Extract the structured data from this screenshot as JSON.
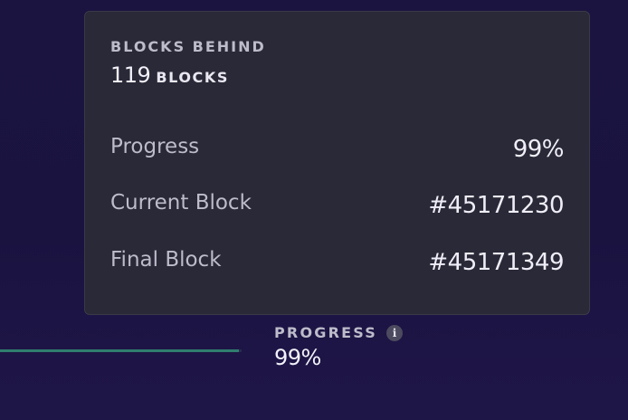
{
  "tooltip": {
    "title": "BLOCKS BEHIND",
    "blocks_count": "119",
    "blocks_unit": "BLOCKS",
    "rows": [
      {
        "label": "Progress",
        "value": "99%"
      },
      {
        "label": "Current Block",
        "value": "#45171230"
      },
      {
        "label": "Final Block",
        "value": "#45171349"
      }
    ]
  },
  "sync": {
    "label": "PROGRESS",
    "info_icon": "info-icon",
    "value": "99%",
    "progress_fraction": 0.99
  },
  "colors": {
    "background": "#1b1440",
    "card": "#2a2937",
    "bar_fill": "#2f7f6f"
  }
}
